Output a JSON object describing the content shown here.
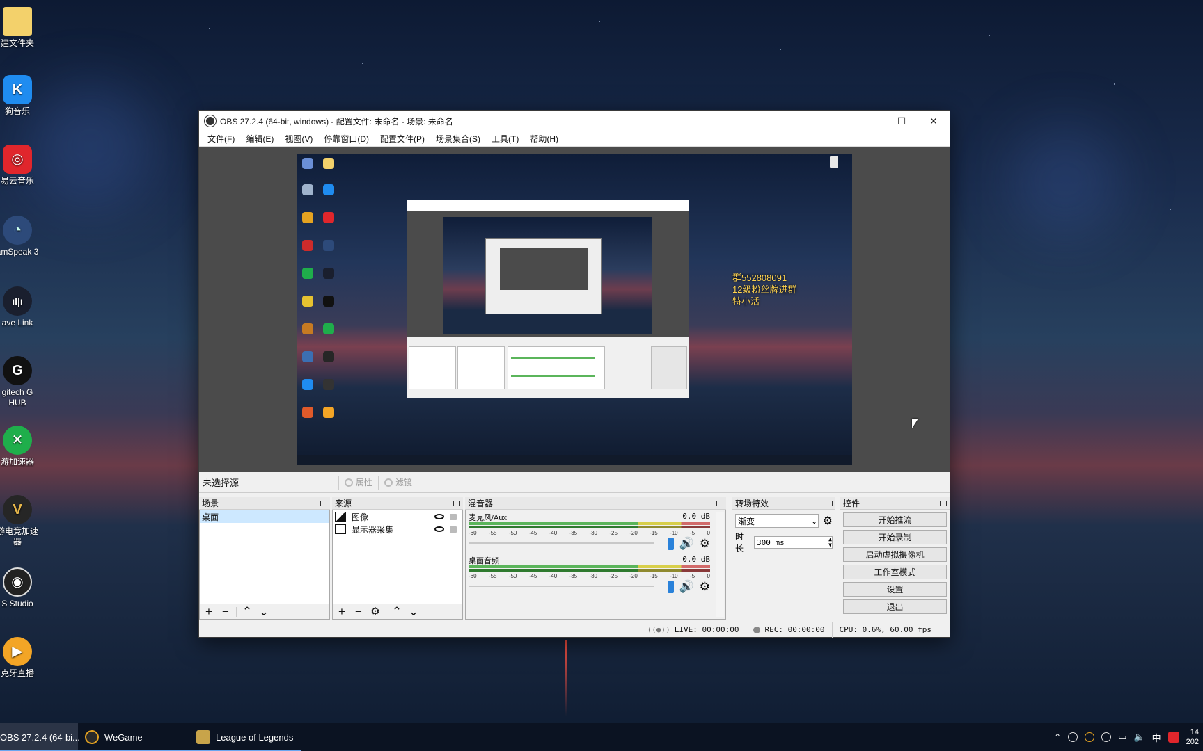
{
  "desktop": {
    "icons": [
      {
        "label": "建文件夹",
        "icon": "folder-icon"
      },
      {
        "label": "狗音乐",
        "icon": "kugou-icon"
      },
      {
        "label": "易云音乐",
        "icon": "netease-music-icon"
      },
      {
        "label": "amSpeak 3",
        "icon": "teamspeak-icon"
      },
      {
        "label": "ave Link",
        "icon": "wave-link-icon"
      },
      {
        "label": "gitech G HUB",
        "icon": "logitech-ghub-icon"
      },
      {
        "label": "游加速器",
        "icon": "accelerator-icon"
      },
      {
        "label": "游电竞加速器",
        "icon": "esports-accelerator-icon"
      },
      {
        "label": "S Studio",
        "icon": "obs-icon"
      },
      {
        "label": "克牙直播",
        "icon": "huya-icon"
      }
    ]
  },
  "window": {
    "title": "OBS 27.2.4 (64-bit, windows) - 配置文件: 未命名 - 场景: 未命名",
    "controls": {
      "minimize": "—",
      "maximize": "☐",
      "close": "✕"
    },
    "menu": [
      "文件(F)",
      "编辑(E)",
      "视图(V)",
      "停靠窗口(D)",
      "配置文件(P)",
      "场景集合(S)",
      "工具(T)",
      "帮助(H)"
    ]
  },
  "preview": {
    "overlay": [
      "群552808091",
      "12级粉丝牌进群",
      "特小活"
    ]
  },
  "source_toolbar": {
    "no_selection": "未选择源",
    "properties": "属性",
    "filters": "滤镜"
  },
  "docks": {
    "scenes": {
      "title": "场景",
      "items": [
        "桌面"
      ]
    },
    "sources": {
      "title": "来源",
      "items": [
        {
          "label": "图像",
          "icon": "image-icon"
        },
        {
          "label": "显示器采集",
          "icon": "monitor-icon"
        }
      ]
    },
    "mixer": {
      "title": "混音器",
      "channels": [
        {
          "name": "麦克风/Aux",
          "level": "0.0 dB"
        },
        {
          "name": "桌面音频",
          "level": "0.0 dB"
        }
      ],
      "ticks": [
        "-60",
        "-55",
        "-50",
        "-45",
        "-40",
        "-35",
        "-30",
        "-25",
        "-20",
        "-15",
        "-10",
        "-5",
        "0"
      ]
    },
    "transitions": {
      "title": "转场特效",
      "selected": "渐变",
      "duration_label": "时长",
      "duration_value": "300 ms"
    },
    "controls": {
      "title": "控件",
      "buttons": [
        "开始推流",
        "开始录制",
        "启动虚拟摄像机",
        "工作室模式",
        "设置",
        "退出"
      ]
    }
  },
  "status": {
    "live": "LIVE: 00:00:00",
    "rec": "REC: 00:00:00",
    "cpu": "CPU: 0.6%, 60.00 fps"
  },
  "taskbar": {
    "items": [
      {
        "label": "OBS 27.2.4 (64-bi...",
        "state": "active"
      },
      {
        "label": "WeGame",
        "state": "open"
      },
      {
        "label": "League of Legends",
        "state": "open"
      }
    ],
    "tray": {
      "ime": "中",
      "time": "14",
      "date": "202"
    }
  },
  "colors": {
    "accent": "#2a82da",
    "selected_row": "#cde8ff",
    "overlay_text": "#ffd34d"
  }
}
